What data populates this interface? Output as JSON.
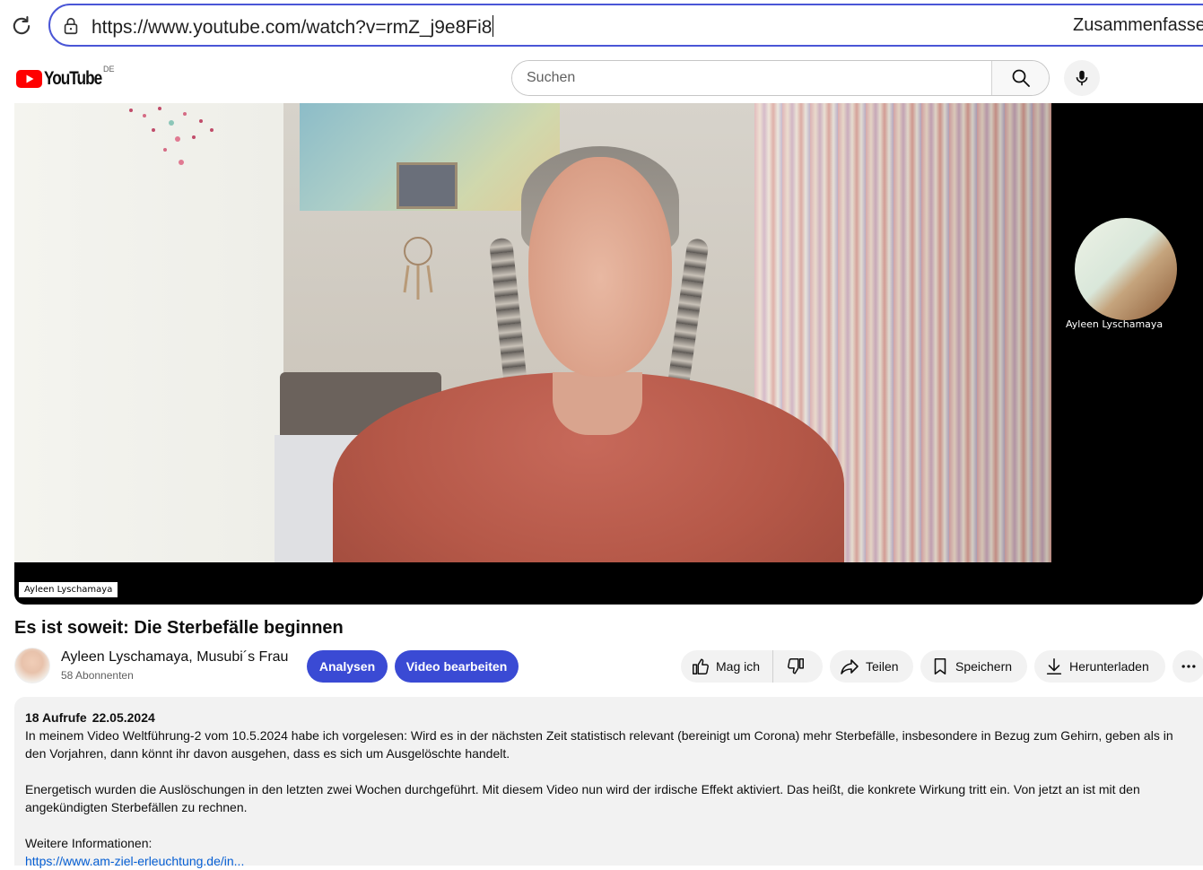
{
  "browser": {
    "url": "https://www.youtube.com/watch?v=rmZ_j9e8Fi8",
    "right_label": "Zusammenfasse"
  },
  "masthead": {
    "logo_text": "YouTube",
    "country_code": "DE",
    "search_placeholder": "Suchen"
  },
  "player": {
    "speaker_name_tag": "Ayleen Lyschamaya",
    "participant_name": "Ayleen Lyschamaya"
  },
  "video": {
    "title": "Es ist soweit: Die Sterbefälle beginnen"
  },
  "channel": {
    "name": "Ayleen Lyschamaya, Musubi´s Frau",
    "subscribers": "58 Abonnenten"
  },
  "actions": {
    "analytics": "Analysen",
    "edit_video": "Video bearbeiten",
    "like": "Mag ich",
    "share": "Teilen",
    "save": "Speichern",
    "download": "Herunterladen"
  },
  "description": {
    "views": "18 Aufrufe",
    "date": "22.05.2024",
    "paragraph1": "In meinem Video Weltführung-2 vom 10.5.2024 habe ich vorgelesen: Wird es in der nächsten Zeit statistisch relevant (bereinigt um Corona) mehr Sterbefälle, insbesondere in Bezug zum Gehirn, geben als in den Vorjahren, dann könnt ihr davon ausgehen, dass es sich um Ausgelöschte handelt.",
    "paragraph2": "Energetisch wurden die Auslöschungen in den letzten zwei Wochen durchgeführt. Mit diesem Video nun wird der irdische Effekt aktiviert. Das heißt, die konkrete Wirkung tritt ein. Von jetzt an ist mit den angekündigten Sterbefällen zu rechnen.",
    "more_info_label": "Weitere Informationen:",
    "link": "https://www.am-ziel-erleuchtung.de/in..."
  },
  "colors": {
    "accent_blue": "#3a4ad4",
    "link_blue": "#065fd4",
    "youtube_red": "#ff0000",
    "address_bar_border": "#4a56d6"
  }
}
